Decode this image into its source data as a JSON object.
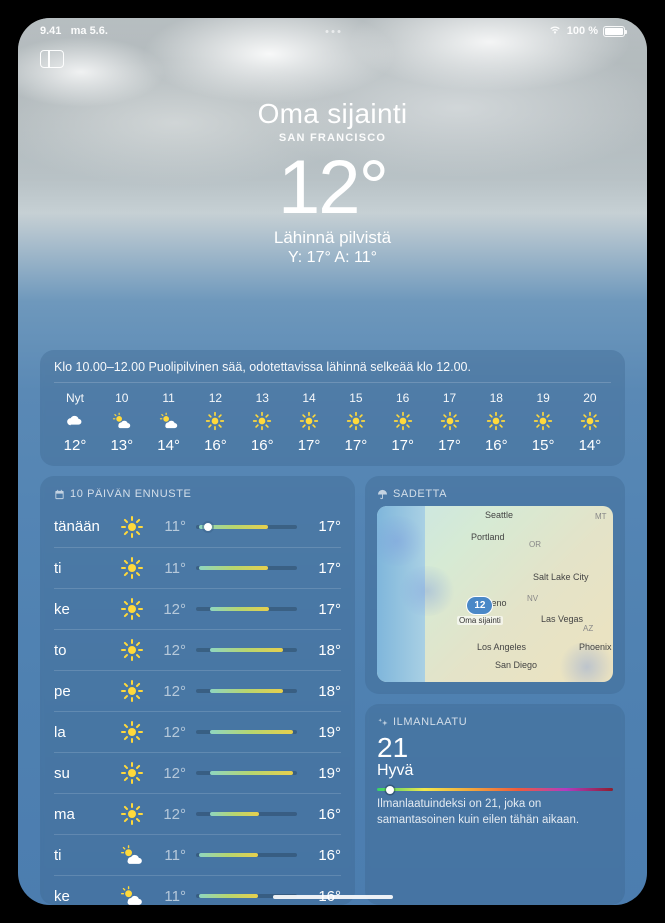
{
  "statusbar": {
    "time": "9.41",
    "date": "ma 5.6.",
    "battery_pct": "100 %"
  },
  "hero": {
    "location_title": "Oma sijainti",
    "location_sub": "SAN FRANCISCO",
    "temperature": "12°",
    "condition": "Lähinnä pilvistä",
    "high_low": "Y: 17° A: 11°"
  },
  "hourly": {
    "summary": "Klo 10.00–12.00 Puolipilvinen sää, odotettavissa lähinnä selkeää klo 12.00.",
    "items": [
      {
        "label": "Nyt",
        "icon": "cloud",
        "temp": "12°"
      },
      {
        "label": "10",
        "icon": "partly",
        "temp": "13°"
      },
      {
        "label": "11",
        "icon": "partly",
        "temp": "14°"
      },
      {
        "label": "12",
        "icon": "sun",
        "temp": "16°"
      },
      {
        "label": "13",
        "icon": "sun",
        "temp": "16°"
      },
      {
        "label": "14",
        "icon": "sun",
        "temp": "17°"
      },
      {
        "label": "15",
        "icon": "sun",
        "temp": "17°"
      },
      {
        "label": "16",
        "icon": "sun",
        "temp": "17°"
      },
      {
        "label": "17",
        "icon": "sun",
        "temp": "17°"
      },
      {
        "label": "18",
        "icon": "sun",
        "temp": "16°"
      },
      {
        "label": "19",
        "icon": "sun",
        "temp": "15°"
      },
      {
        "label": "20",
        "icon": "sun",
        "temp": "14°"
      }
    ]
  },
  "tenday": {
    "header": "10 PÄIVÄN ENNUSTE",
    "days": [
      {
        "name": "tänään",
        "icon": "sun",
        "low": "11°",
        "high": "17°",
        "fillLeft": 3,
        "fillWidth": 68,
        "dot": 8
      },
      {
        "name": "ti",
        "icon": "sun",
        "low": "11°",
        "high": "17°",
        "fillLeft": 3,
        "fillWidth": 68
      },
      {
        "name": "ke",
        "icon": "sun",
        "low": "12°",
        "high": "17°",
        "fillLeft": 14,
        "fillWidth": 58
      },
      {
        "name": "to",
        "icon": "sun",
        "low": "12°",
        "high": "18°",
        "fillLeft": 14,
        "fillWidth": 72
      },
      {
        "name": "pe",
        "icon": "sun",
        "low": "12°",
        "high": "18°",
        "fillLeft": 14,
        "fillWidth": 72
      },
      {
        "name": "la",
        "icon": "sun",
        "low": "12°",
        "high": "19°",
        "fillLeft": 14,
        "fillWidth": 82
      },
      {
        "name": "su",
        "icon": "sun",
        "low": "12°",
        "high": "19°",
        "fillLeft": 14,
        "fillWidth": 82
      },
      {
        "name": "ma",
        "icon": "sun",
        "low": "12°",
        "high": "16°",
        "fillLeft": 14,
        "fillWidth": 48
      },
      {
        "name": "ti",
        "icon": "partly",
        "low": "11°",
        "high": "16°",
        "fillLeft": 3,
        "fillWidth": 58
      },
      {
        "name": "ke",
        "icon": "partly",
        "low": "11°",
        "high": "16°",
        "fillLeft": 3,
        "fillWidth": 58
      }
    ]
  },
  "precip": {
    "header": "SADETTA",
    "pin_temp": "12",
    "pin_label": "Oma sijainti",
    "cities": {
      "seattle": "Seattle",
      "portland": "Portland",
      "slc": "Salt Lake City",
      "reno": "Reno",
      "lv": "Las Vegas",
      "la": "Los Angeles",
      "sd": "San Diego",
      "phx": "Phoenix"
    },
    "states": {
      "or": "OR",
      "nv": "NV",
      "az": "AZ",
      "mt": "MT"
    }
  },
  "air": {
    "header": "ILMANLAATU",
    "value": "21",
    "status": "Hyvä",
    "desc": "Ilmanlaatuindeksi on 21, joka on samantasoinen kuin eilen tähän aikaan.",
    "dot_pct": 4
  }
}
